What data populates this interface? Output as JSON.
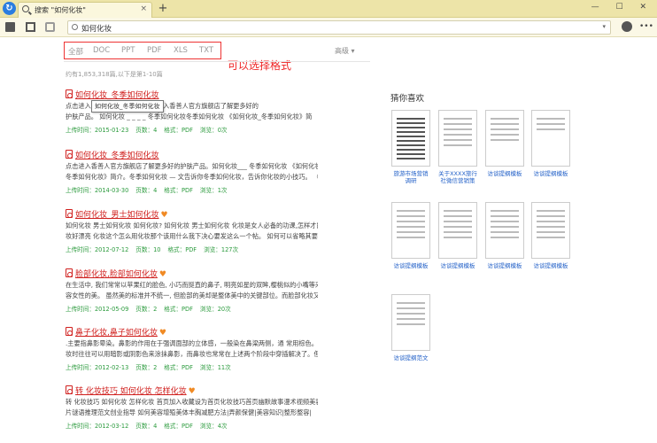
{
  "tab": {
    "title": "搜索 \"如何化妆\"",
    "close": "×"
  },
  "new_tab": "+",
  "window_controls": "— ☐ ✕",
  "toolbar": {
    "address": "如何化妆",
    "dropdown": "▾",
    "menu": "•••"
  },
  "filters": [
    "全部",
    "DOC",
    "PPT",
    "PDF",
    "XLS",
    "TXT"
  ],
  "annotation": "可以选择格式",
  "advanced": "高级 ▾",
  "result_count": "约有1,853,318篇,以下是第1-10篇",
  "tooltip": "如何化妆_冬季如何化妆",
  "results": [
    {
      "title": "如何化妆_冬季如何化妆",
      "heart": false,
      "desc1": "点击进入                              多好的护肤产品。点击进入香善人官方旗舰店了解更多好的",
      "desc2": "护肤产品。 如何化妆 _ _ _ _ 冬季如何化妆冬季如何化妆 《如何化妆_冬季如何化妆》简",
      "date": "上传时间：2015-01-23",
      "pages": "页数：4",
      "format": "格式：PDF",
      "views": "浏览：0次"
    },
    {
      "title": "如何化妆_冬季如何化妆",
      "heart": false,
      "desc1": "点击进入香善人官方旗舰店了解更多好的护肤产品。如何化妆___ 冬季如何化妆 《如何化妆_",
      "desc2": "冬季如何化妆》简介。冬季如何化妆 — 文告诉你冬季如何化妆，告诉你化妆的小技巧。 《如",
      "date": "上传时间：2014-03-30",
      "pages": "页数：4",
      "format": "格式：PDF",
      "views": "浏览：1次"
    },
    {
      "title": "如何化妆_男士如何化妆",
      "heart": true,
      "desc1": "如何化妆 男士如何化妆 如何化妆? 如何化妆 男士如何化妆 化妆是女人必备的功课,怎样才能化",
      "desc2": "妆好漂亮 化妆这个怎么用化妆那个该用什么我下决心要发这么一个帖。 如何可以省略其要弃",
      "date": "上传时间：2012-07-12",
      "pages": "页数：10",
      "format": "格式：PDF",
      "views": "浏览：127次"
    },
    {
      "title": "脸部化妆,脸部如何化妆",
      "heart": true,
      "desc1": "在生活中, 我们常常以苹果红的脸色, 小巧而挺直的鼻子, 明亮如星的双眸,樱桃似的小嘴等来形",
      "desc2": "容女性的美。 虽然美的标准并不统一, 但脸部的美却是整体美中的关键部位。而脸部化妆又是",
      "date": "上传时间：2012-05-09",
      "pages": "页数：2",
      "format": "格式：PDF",
      "views": "浏览：20次"
    },
    {
      "title": "鼻子化妆,鼻子如何化妆",
      "heart": true,
      "desc1": ".主要指鼻影晕染。鼻影的作用在于强调面部的立体感，一般染在鼻梁两侧，通 常用棕色。在化",
      "desc2": "妆时往往可以用暗影或阴影色来涂抹鼻影，而鼻妆也常常在上述两个阶段中穿插解决了。但",
      "date": "上传时间：2012-02-13",
      "pages": "页数：2",
      "format": "格式：PDF",
      "views": "浏览：11次"
    },
    {
      "title": "转 化妆技巧 如何化妆 怎样化妆",
      "heart": true,
      "desc1": "转 化妆技巧 如何化妆 怎样化妆 首页加入收藏设为首页化妆技巧首页幽默故事漫术视频美容图",
      "desc2": "片谜语推理范文创业指导 如何美容增殖美体丰胸减肥方法|弄颜保健|美容知识|整形整容|",
      "date": "上传时间：2012-03-12",
      "pages": "页数：4",
      "format": "格式：PDF",
      "views": "浏览：4次"
    }
  ],
  "sidebar": {
    "title": "猜你喜欢",
    "cards": [
      {
        "label": "旅游市场营销调研"
      },
      {
        "label": "关于XXXX旅行社微信营销策"
      },
      {
        "label": "访谈提纲模板"
      },
      {
        "label": "访谈提纲模板"
      },
      {
        "label": "访谈提纲模板"
      },
      {
        "label": "访谈提纲模板"
      },
      {
        "label": "访谈提纲模板"
      },
      {
        "label": "访谈提纲模板"
      },
      {
        "label": "访谈提纲范文"
      }
    ]
  }
}
